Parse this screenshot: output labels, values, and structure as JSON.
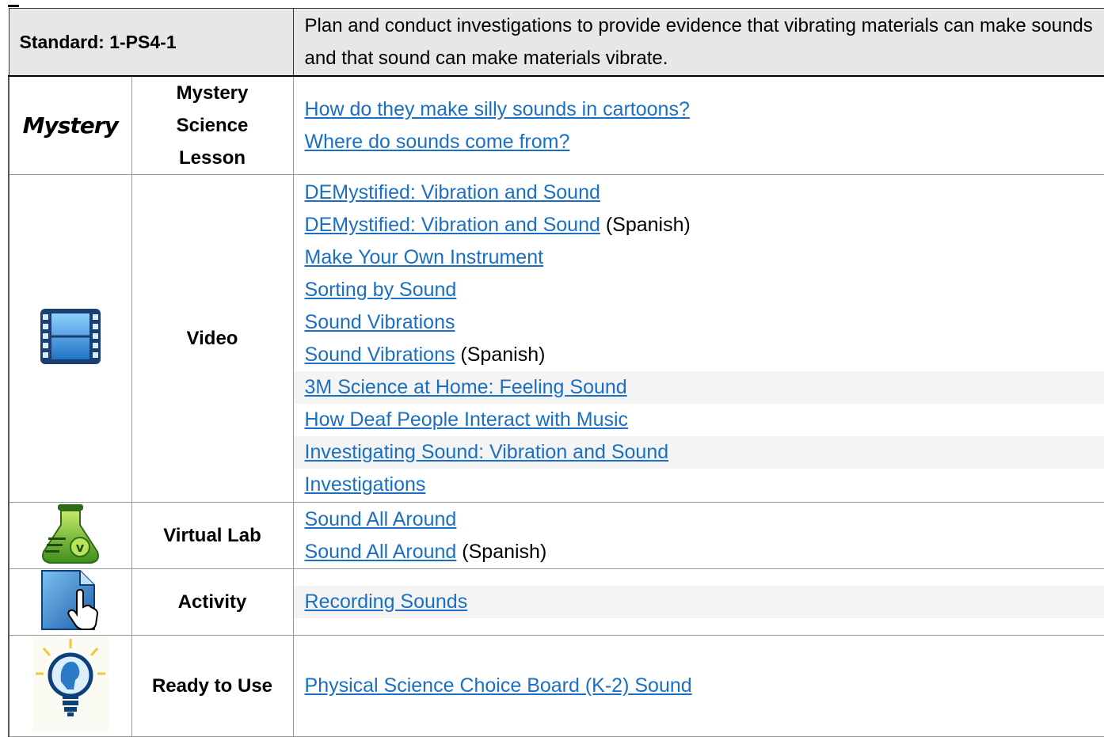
{
  "header": {
    "standard_label": "Standard: 1-PS4-1",
    "description": "Plan and conduct investigations to provide evidence that vibrating materials can make sounds and that sound can make materials vibrate."
  },
  "rows": [
    {
      "icon": "mystery-logo",
      "logo_text": "Mystery",
      "type_lines": [
        "Mystery",
        "Science",
        "Lesson"
      ],
      "links": [
        {
          "text": "How do they make silly sounds in cartoons?",
          "suffix": ""
        },
        {
          "text": "Where do sounds come from?",
          "suffix": ""
        }
      ]
    },
    {
      "icon": "film-strip-icon",
      "type_lines": [
        "Video"
      ],
      "links": [
        {
          "text": "DEMystified: Vibration and Sound",
          "suffix": ""
        },
        {
          "text": "DEMystified: Vibration and Sound",
          "suffix": " (Spanish)"
        },
        {
          "text": "Make Your Own Instrument",
          "suffix": ""
        },
        {
          "text": "Sorting by Sound",
          "suffix": ""
        },
        {
          "text": "Sound Vibrations",
          "suffix": ""
        },
        {
          "text": "Sound Vibrations",
          "suffix": " (Spanish)"
        },
        {
          "text": "3M Science at Home: Feeling Sound",
          "suffix": ""
        },
        {
          "text": "How Deaf People Interact with Music",
          "suffix": ""
        },
        {
          "text": "Investigating Sound: Vibration and Sound",
          "suffix": ""
        },
        {
          "text": "Investigations",
          "suffix": ""
        }
      ]
    },
    {
      "icon": "flask-icon",
      "type_lines": [
        "Virtual Lab"
      ],
      "links": [
        {
          "text": "Sound All Around",
          "suffix": ""
        },
        {
          "text": "Sound All Around",
          "suffix": " (Spanish)"
        }
      ]
    },
    {
      "icon": "document-hand-icon",
      "type_lines": [
        "Activity"
      ],
      "links": [
        {
          "text": "Recording Sounds",
          "suffix": ""
        }
      ]
    },
    {
      "icon": "lightbulb-icon",
      "type_lines": [
        "Ready to Use"
      ],
      "links": [
        {
          "text": "Physical Science Choice Board (K-2) Sound",
          "suffix": ""
        }
      ]
    }
  ],
  "colors": {
    "link": "#1a6fc4",
    "header_bg": "#e7e7e7"
  }
}
